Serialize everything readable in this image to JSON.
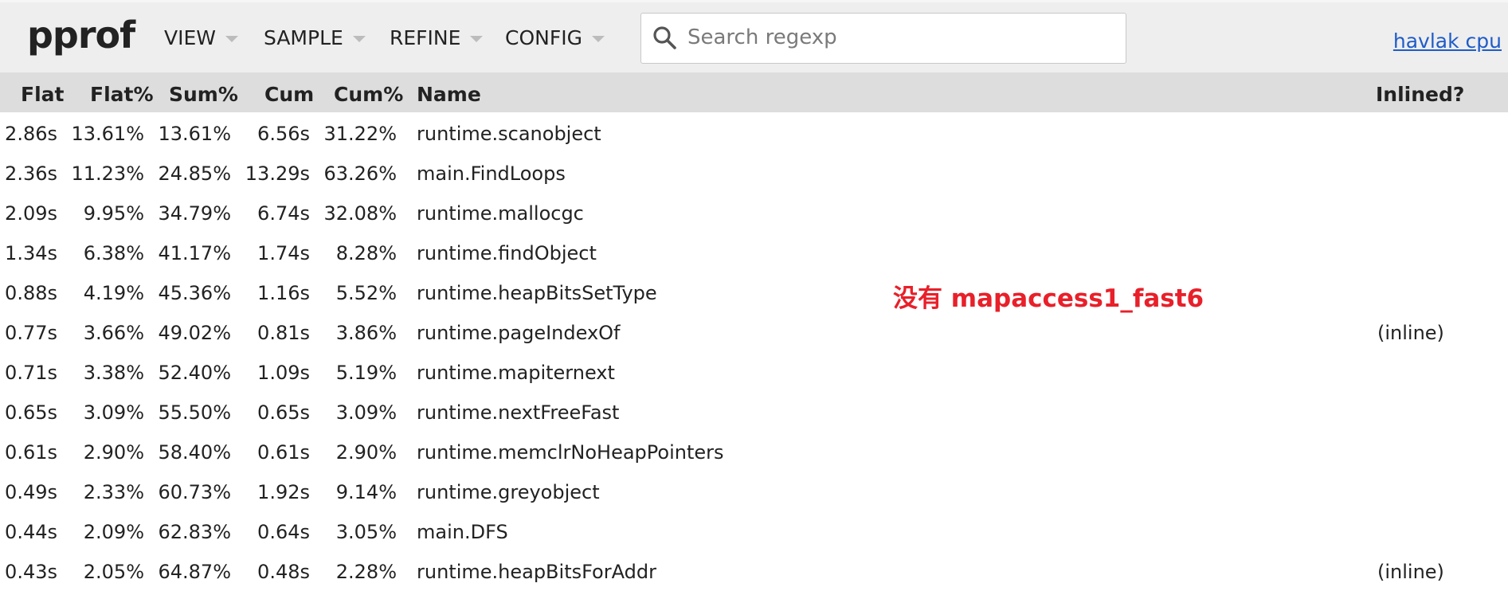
{
  "header": {
    "logo": "pprof",
    "menus": [
      {
        "label": "VIEW"
      },
      {
        "label": "SAMPLE"
      },
      {
        "label": "REFINE"
      },
      {
        "label": "CONFIG"
      }
    ],
    "search": {
      "placeholder": "Search regexp",
      "value": ""
    },
    "profile_link": "havlak cpu"
  },
  "table": {
    "columns": [
      "Flat",
      "Flat%",
      "Sum%",
      "Cum",
      "Cum%",
      "Name",
      "Inlined?"
    ],
    "rows": [
      {
        "flat": "2.86s",
        "flat_pct": "13.61%",
        "sum_pct": "13.61%",
        "cum": "6.56s",
        "cum_pct": "31.22%",
        "name": "runtime.scanobject",
        "inlined": ""
      },
      {
        "flat": "2.36s",
        "flat_pct": "11.23%",
        "sum_pct": "24.85%",
        "cum": "13.29s",
        "cum_pct": "63.26%",
        "name": "main.FindLoops",
        "inlined": ""
      },
      {
        "flat": "2.09s",
        "flat_pct": "9.95%",
        "sum_pct": "34.79%",
        "cum": "6.74s",
        "cum_pct": "32.08%",
        "name": "runtime.mallocgc",
        "inlined": ""
      },
      {
        "flat": "1.34s",
        "flat_pct": "6.38%",
        "sum_pct": "41.17%",
        "cum": "1.74s",
        "cum_pct": "8.28%",
        "name": "runtime.findObject",
        "inlined": ""
      },
      {
        "flat": "0.88s",
        "flat_pct": "4.19%",
        "sum_pct": "45.36%",
        "cum": "1.16s",
        "cum_pct": "5.52%",
        "name": "runtime.heapBitsSetType",
        "inlined": ""
      },
      {
        "flat": "0.77s",
        "flat_pct": "3.66%",
        "sum_pct": "49.02%",
        "cum": "0.81s",
        "cum_pct": "3.86%",
        "name": "runtime.pageIndexOf",
        "inlined": "(inline)"
      },
      {
        "flat": "0.71s",
        "flat_pct": "3.38%",
        "sum_pct": "52.40%",
        "cum": "1.09s",
        "cum_pct": "5.19%",
        "name": "runtime.mapiternext",
        "inlined": ""
      },
      {
        "flat": "0.65s",
        "flat_pct": "3.09%",
        "sum_pct": "55.50%",
        "cum": "0.65s",
        "cum_pct": "3.09%",
        "name": "runtime.nextFreeFast",
        "inlined": ""
      },
      {
        "flat": "0.61s",
        "flat_pct": "2.90%",
        "sum_pct": "58.40%",
        "cum": "0.61s",
        "cum_pct": "2.90%",
        "name": "runtime.memclrNoHeapPointers",
        "inlined": ""
      },
      {
        "flat": "0.49s",
        "flat_pct": "2.33%",
        "sum_pct": "60.73%",
        "cum": "1.92s",
        "cum_pct": "9.14%",
        "name": "runtime.greyobject",
        "inlined": ""
      },
      {
        "flat": "0.44s",
        "flat_pct": "2.09%",
        "sum_pct": "62.83%",
        "cum": "0.64s",
        "cum_pct": "3.05%",
        "name": "main.DFS",
        "inlined": ""
      },
      {
        "flat": "0.43s",
        "flat_pct": "2.05%",
        "sum_pct": "64.87%",
        "cum": "0.48s",
        "cum_pct": "2.28%",
        "name": "runtime.heapBitsForAddr",
        "inlined": "(inline)"
      }
    ]
  },
  "annotation": {
    "text": "没有 mapaccess1_fast6",
    "color": "#e8202a"
  },
  "colors": {
    "header_bg": "#eeeeee",
    "table_header_bg": "#dddddd",
    "link": "#1e5cc8"
  }
}
